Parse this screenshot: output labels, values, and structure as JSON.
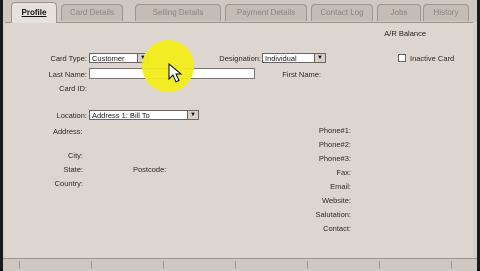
{
  "tabs": [
    {
      "label": "Profile"
    },
    {
      "label": "Card Details"
    },
    {
      "label": "Selling Details"
    },
    {
      "label": "Payment Details"
    },
    {
      "label": "Contact Log"
    },
    {
      "label": "Jobs"
    },
    {
      "label": "History"
    }
  ],
  "header": {
    "ar_balance_label": "A/R Balance"
  },
  "form": {
    "card_type_label": "Card Type:",
    "card_type_value": "Customer",
    "designation_label": "Designation:",
    "designation_value": "Individual",
    "inactive_card_label": "Inactive Card",
    "last_name_label": "Last Name:",
    "last_name_value": "",
    "first_name_label": "First Name:",
    "card_id_label": "Card ID:",
    "location_label": "Location:",
    "location_value": "Address 1:  Bill To",
    "address_label": "Address:",
    "city_label": "City:",
    "state_label": "State:",
    "postcode_label": "Postcode:",
    "country_label": "Country:",
    "phone1_label": "Phone#1:",
    "phone2_label": "Phone#2:",
    "phone3_label": "Phone#3:",
    "fax_label": "Fax:",
    "email_label": "Email:",
    "website_label": "Website:",
    "salutation_label": "Salutation:",
    "contact_label": "Contact:"
  },
  "colors": {
    "highlight": "#f3ec1a"
  }
}
